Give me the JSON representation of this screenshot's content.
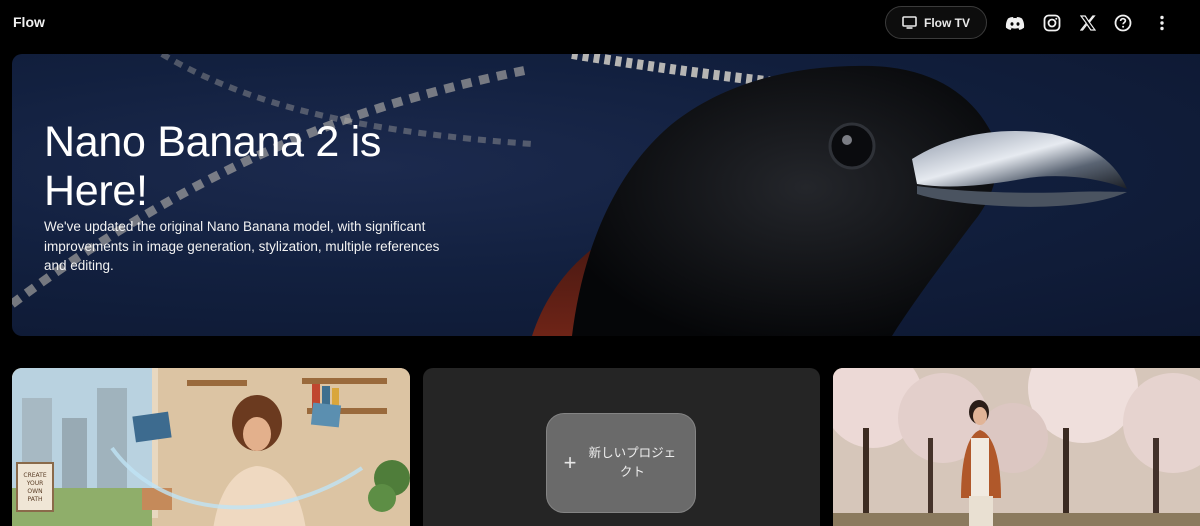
{
  "app": {
    "title": "Flow"
  },
  "header": {
    "flow_tv_label": "Flow TV",
    "icons": [
      "monitor-icon",
      "discord-icon",
      "instagram-icon",
      "x-icon",
      "help-icon",
      "more-vert-icon"
    ]
  },
  "hero": {
    "title": "Nano Banana 2 is Here!",
    "description": "We've updated the original Nano Banana model, with significant improvements in image generation, stylization, multiple references and editing."
  },
  "cards": {
    "new_project_label": "新しいプロジェクト",
    "card1_text": [
      "CREATE",
      "YOUR",
      "OWN",
      "PATH"
    ]
  },
  "colors": {
    "background": "#000000",
    "hero_bg": "#12203f",
    "card_dark": "#252525",
    "button_gray": "#6a6a6a"
  }
}
